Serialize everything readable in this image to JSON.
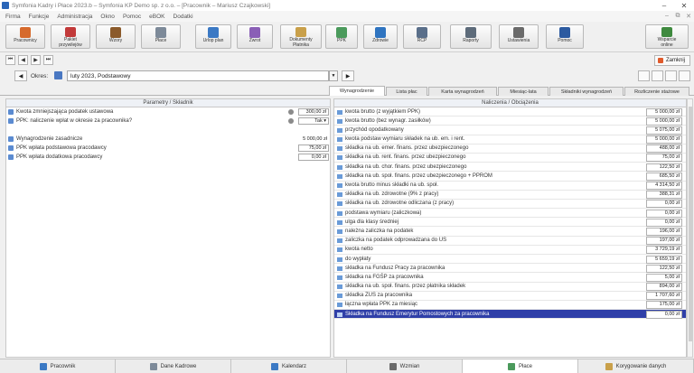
{
  "window": {
    "title": "Symfonia Kadry i Płace 2023.b – Symfonia KP Demo sp. z o.o. – [Pracownik – Mariusz Czajkowski]",
    "minimize": "–",
    "close": "✕"
  },
  "menu": {
    "items": [
      "Firma",
      "Funkcje",
      "Administracja",
      "Okno",
      "Pomoc",
      "eBOK",
      "Dodatki"
    ],
    "right": [
      "–",
      "⧉",
      "✕"
    ]
  },
  "toolbar": {
    "buttons": [
      {
        "label": "Pracownicy",
        "icon": "people-icon",
        "color": "#d66a2c"
      },
      {
        "label": "Pakiet\nprzywilejów",
        "icon": "calendar-icon",
        "color": "#c23a3a"
      },
      {
        "label": "Wzory",
        "icon": "folder-icon",
        "color": "#8b5a2b"
      },
      {
        "label": "Płace",
        "icon": "document-icon",
        "color": "#7d8a99"
      },
      {
        "label": "Urlop plan",
        "icon": "calendar-icon",
        "color": "#3b79c4"
      },
      {
        "label": "Zwrot",
        "icon": "return-icon",
        "color": "#8a5fb6"
      },
      {
        "label": "Dokumenty\nPłatnika",
        "icon": "documents-icon",
        "color": "#c9a04a"
      },
      {
        "label": "PPK",
        "icon": "chart-icon",
        "color": "#4b9a5c"
      },
      {
        "label": "Zdrowie",
        "icon": "globe-icon",
        "color": "#2f74c0"
      },
      {
        "label": "RCP",
        "icon": "clock-icon",
        "color": "#5a6f8a"
      },
      {
        "label": "Raporty",
        "icon": "report-icon",
        "color": "#5d6b7a"
      },
      {
        "label": "Ustawienia",
        "icon": "tools-icon",
        "color": "#6a6a6a"
      },
      {
        "label": "Pomoc",
        "icon": "help-icon",
        "color": "#2c5aa0"
      },
      {
        "label": "Wsparcie\nonline",
        "icon": "support-icon",
        "color": "#3f8a3f"
      }
    ]
  },
  "nav": {
    "first": "⏮",
    "prev": "◀",
    "next": "▶",
    "last": "⏭",
    "zamknij": "Zamknij"
  },
  "period": {
    "prev": "◀",
    "next": "▶",
    "label": "Okres:",
    "value": "luty 2023, Podstawowy",
    "dropdown": "▼"
  },
  "tabs": [
    "Wynagrodzenie",
    "Lista płac",
    "Karta wynagrodzeń",
    "Miesiąc-lata",
    "Składniki wynagrodzeń",
    "Rozliczenie stażowe"
  ],
  "left": {
    "header": "Parametry / Składnik",
    "rows": [
      {
        "label": "Kwota zmniejszająca podatek ustawowa",
        "value": "300,00 zł",
        "mini": true,
        "box": true
      },
      {
        "label": "PPK: naliczenie wpłat w okresie za pracownika?",
        "value": "Tak ▾",
        "mini": true,
        "box": true
      },
      {
        "label": "",
        "value": "",
        "mini": false,
        "box": false
      },
      {
        "label": "Wynagrodzenie zasadnicze",
        "value": "5 000,00 zł",
        "mini": false,
        "box": false
      },
      {
        "label": "PPK wpłata podstawowa pracodawcy",
        "value": "75,00 zł",
        "mini": false,
        "box": true
      },
      {
        "label": "PPK wpłata dodatkowa pracodawcy",
        "value": "0,00 zł",
        "mini": false,
        "box": true
      }
    ]
  },
  "right": {
    "header": "Naliczenia / Obciążenia",
    "rows": [
      {
        "label": "kwota brutto (z wyjątkiem PPK)",
        "value": "5 000,00 zł"
      },
      {
        "label": "kwota brutto (bez wynagr. zasiłków)",
        "value": "5 000,00 zł"
      },
      {
        "label": "przychód opodatkowany",
        "value": "5 075,00 zł"
      },
      {
        "label": "kwota podstaw wymiaru składek na ub. em. i rent.",
        "value": "5 000,00 zł"
      },
      {
        "label": "składka na ub. emer. finans. przez ubezpieczonego",
        "value": "488,00 zł"
      },
      {
        "label": "składka na ub. rent. finans. przez ubezpieczonego",
        "value": "75,00 zł"
      },
      {
        "label": "składka na ub. chor. finans. przez ubezpieczonego",
        "value": "122,50 zł"
      },
      {
        "label": "składka na ub. społ. finans. przez ubezpieczonego + PPROM",
        "value": "685,50 zł"
      },
      {
        "label": "kwota brutto minus składki na ub. społ.",
        "value": "4 314,50 zł"
      },
      {
        "label": "składka na ub. zdrowotne (9% z pracy)",
        "value": "388,31 zł"
      },
      {
        "label": "składka na ub. zdrowotne odliczana (z pracy)",
        "value": "0,00 zł"
      },
      {
        "label": "podstawa wymiaru (zaliczkowa)",
        "value": "0,00 zł"
      },
      {
        "label": "ulga dla klasy średniej",
        "value": "0,00 zł"
      },
      {
        "label": "należna zaliczka na podatek",
        "value": "196,00 zł"
      },
      {
        "label": "zaliczka na podatek odprowadzana do US",
        "value": "197,00 zł"
      },
      {
        "label": "kwota netto",
        "value": "3 729,19 zł"
      },
      {
        "label": "do wypłaty",
        "value": "5 659,19 zł"
      },
      {
        "label": "składka na Fundusz Pracy za pracownika",
        "value": "122,50 zł"
      },
      {
        "label": "składka na FGŚP za pracownika",
        "value": "5,00 zł"
      },
      {
        "label": "składka na ub. społ. finans. przez płatnika składek",
        "value": "894,00 zł"
      },
      {
        "label": "składka ZUS za pracownika",
        "value": "1 707,60 zł"
      },
      {
        "label": "łączna wpłata PPK za miesiąc",
        "value": "175,00 zł"
      },
      {
        "label": "Składka na Fundusz Emerytur Pomostowych za pracownika",
        "value": "0,00 zł",
        "selected": true
      }
    ]
  },
  "bottom": {
    "tabs": [
      {
        "label": "Pracownik",
        "color": "#3b79c4"
      },
      {
        "label": "Dane Kadrowe",
        "color": "#7d8a99"
      },
      {
        "label": "Kalendarz",
        "color": "#3b79c4"
      },
      {
        "label": "Wzmian",
        "color": "#6a6a6a"
      },
      {
        "label": "Płace",
        "color": "#4b9a5c",
        "active": true
      },
      {
        "label": "Korygowanie danych",
        "color": "#c9a04a"
      }
    ]
  }
}
